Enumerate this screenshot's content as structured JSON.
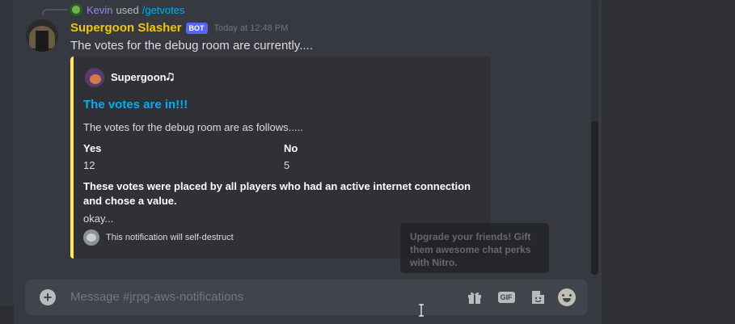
{
  "reply": {
    "user": "Kevin",
    "verb": "used",
    "command": "/getvotes"
  },
  "message": {
    "username": "Supergoon Slasher",
    "badge": "BOT",
    "timestamp": "Today at 12:48 PM",
    "text": "The votes for the debug room are currently...."
  },
  "embed": {
    "accent_color": "#fee75c",
    "author": "Supergoon🎝",
    "title": "The votes are in!!!",
    "description": "The votes for the debug room are as follows.....",
    "fields": [
      {
        "name": "Yes",
        "value": "12"
      },
      {
        "name": "No",
        "value": "5"
      },
      {
        "name": "These votes were placed by all players who had an active internet connection and chose a value.",
        "value": "okay..."
      }
    ],
    "footer": "This notification will self-destruct"
  },
  "tooltip": {
    "text": "Upgrade your friends! Gift them awesome chat perks with Nitro."
  },
  "composer": {
    "placeholder": "Message #jrpg-aws-notifications",
    "gif_label": "GIF"
  }
}
